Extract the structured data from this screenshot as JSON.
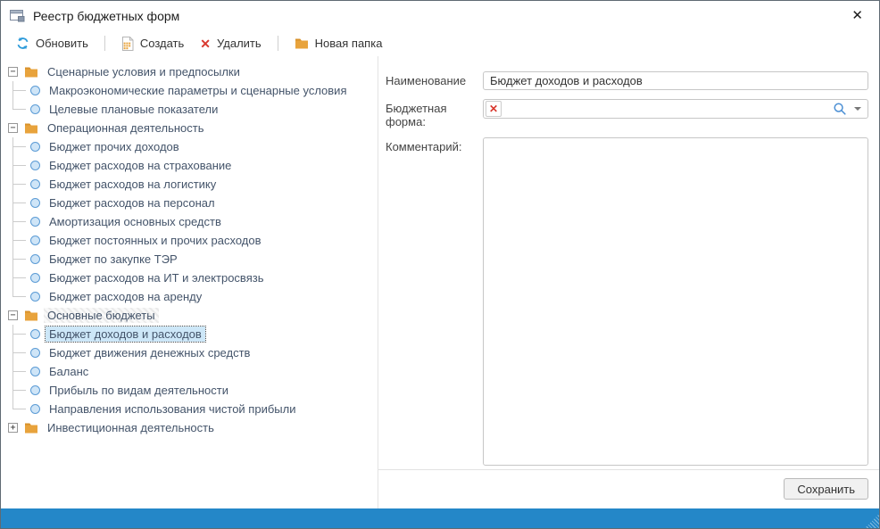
{
  "window": {
    "title": "Реестр бюджетных форм"
  },
  "icons": {
    "close": "✕",
    "delete": "✕",
    "clear": "✕",
    "collapse": "−",
    "expand": "+"
  },
  "toolbar": {
    "refresh": "Обновить",
    "create": "Создать",
    "delete": "Удалить",
    "new_folder": "Новая папка"
  },
  "tree": {
    "nodes": [
      {
        "label": "Сценарные условия и предпосылки",
        "state": "expanded",
        "children": [
          {
            "label": "Макроэкономические параметры и сценарные условия"
          },
          {
            "label": "Целевые плановые показатели"
          }
        ]
      },
      {
        "label": "Операционная деятельность",
        "state": "expanded",
        "children": [
          {
            "label": "Бюджет прочих доходов"
          },
          {
            "label": "Бюджет расходов на страхование"
          },
          {
            "label": "Бюджет расходов на логистику"
          },
          {
            "label": "Бюджет расходов на персонал"
          },
          {
            "label": "Амортизация основных средств"
          },
          {
            "label": "Бюджет постоянных и прочих расходов"
          },
          {
            "label": "Бюджет по закупке ТЭР"
          },
          {
            "label": "Бюджет расходов на ИТ и электросвязь"
          },
          {
            "label": "Бюджет расходов на аренду"
          }
        ]
      },
      {
        "label": "Основные бюджеты",
        "state": "expanded",
        "hatched": true,
        "children": [
          {
            "label": "Бюджет доходов и расходов",
            "selected": true
          },
          {
            "label": "Бюджет движения денежных средств"
          },
          {
            "label": "Баланс"
          },
          {
            "label": "Прибыль по видам деятельности"
          },
          {
            "label": "Направления использования чистой прибыли"
          }
        ]
      },
      {
        "label": "Инвестиционная деятельность",
        "state": "collapsed",
        "children": []
      }
    ]
  },
  "form": {
    "name_label": "Наименование",
    "name_value": "Бюджет доходов и расходов",
    "budget_form_label": "Бюджетная форма:",
    "budget_form_value": "",
    "comment_label": "Комментарий:",
    "comment_value": "",
    "save_label": "Сохранить"
  },
  "colors": {
    "accent_blue": "#2487C8",
    "folder_orange": "#E8A33C",
    "danger_red": "#D9382E",
    "selection_blue": "#cde7f8",
    "refresh_blue": "#2E9BDA"
  }
}
